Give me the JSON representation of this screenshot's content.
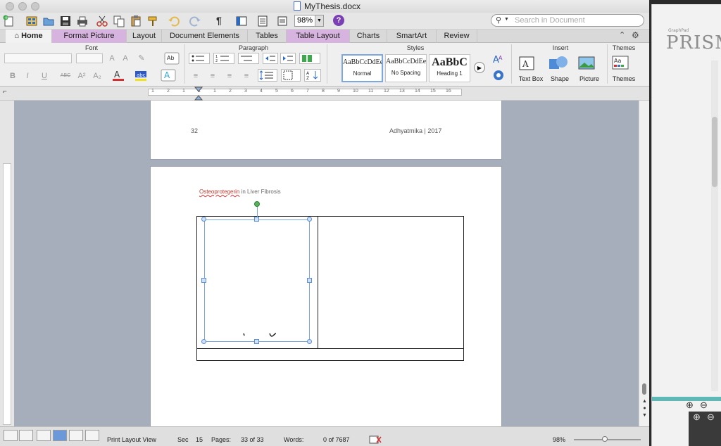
{
  "window": {
    "title": "MyThesis.docx"
  },
  "toolbar": {
    "zoom_value": "98%",
    "search_placeholder": "Search in Document"
  },
  "ribbon_tabs": [
    {
      "label": "Home"
    },
    {
      "label": "Format Picture"
    },
    {
      "label": "Layout"
    },
    {
      "label": "Document Elements"
    },
    {
      "label": "Tables"
    },
    {
      "label": "Table Layout"
    },
    {
      "label": "Charts"
    },
    {
      "label": "SmartArt"
    },
    {
      "label": "Review"
    }
  ],
  "groups": {
    "font": "Font",
    "paragraph": "Paragraph",
    "styles": "Styles",
    "insert": "Insert",
    "themes": "Themes"
  },
  "styles": [
    {
      "sample": "AaBbCcDdEe",
      "name": "Normal"
    },
    {
      "sample": "AaBbCcDdEe",
      "name": "No Spacing"
    },
    {
      "sample": "AaBbC",
      "name": "Heading 1"
    }
  ],
  "insert": {
    "text_box": "Text Box",
    "shape": "Shape",
    "picture": "Picture",
    "themes": "Themes"
  },
  "ruler": {
    "numbers": [
      "1",
      "2",
      "1",
      "1",
      "1",
      "2",
      "3",
      "4",
      "5",
      "6",
      "7",
      "8",
      "9",
      "10",
      "11",
      "12",
      "13",
      "14",
      "15",
      "16"
    ]
  },
  "document": {
    "prev_page_number": "32",
    "prev_page_header": "Adhyatmika | 2017",
    "running_head_misspelled": "Osteoprotegerin",
    "running_head_rest": " in Liver Fibrosis"
  },
  "status": {
    "view": "Print Layout View",
    "sec_label": "Sec",
    "sec_value": "15",
    "pages_label": "Pages:",
    "pages_value": "33 of 33",
    "words_label": "Words:",
    "words_value": "0 of 7687",
    "zoom": "98%"
  },
  "background_app": {
    "brand_small": "GraphPad",
    "brand": "PRISM"
  },
  "colors": {
    "format_picture_tab": "#d7b3df",
    "doc_background": "#a7aebb",
    "selection": "#7aa6db",
    "rotate_handle": "#58b25d"
  }
}
